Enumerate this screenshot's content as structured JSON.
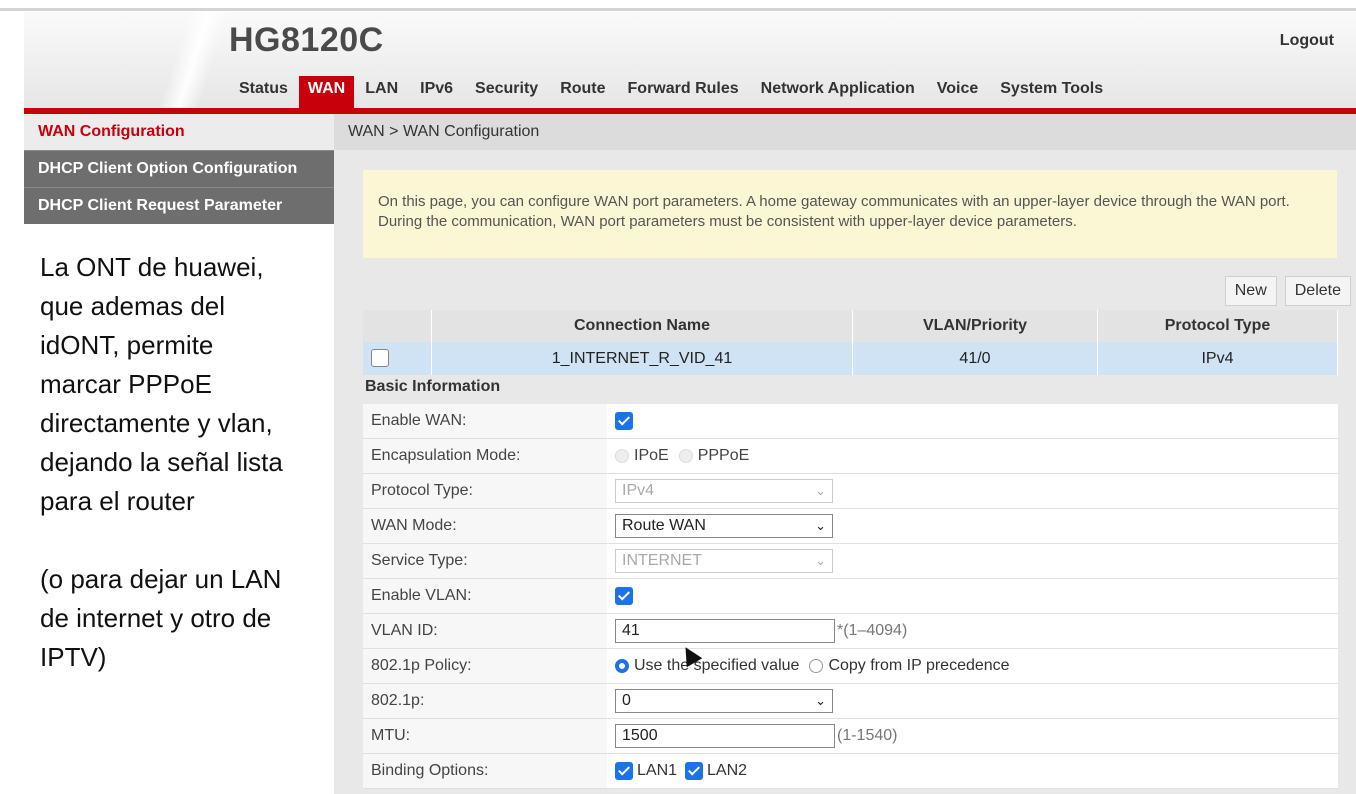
{
  "header": {
    "title": "HG8120C",
    "logout": "Logout"
  },
  "nav": [
    "Status",
    "WAN",
    "LAN",
    "IPv6",
    "Security",
    "Route",
    "Forward Rules",
    "Network Application",
    "Voice",
    "System Tools"
  ],
  "nav_active": "WAN",
  "sidebar": {
    "items": [
      "WAN Configuration",
      "DHCP Client Option Configuration",
      "DHCP Client Request Parameter"
    ]
  },
  "annotation": {
    "para1": "La ONT de huawei,\nque ademas del\nidONT, permite\nmarcar PPPoE\ndirectamente y vlan,\ndejando la señal lista\npara el router",
    "para2": "(o para dejar un LAN\nde internet y otro de\nIPTV)"
  },
  "breadcrumb": "WAN > WAN Configuration",
  "notice": "On this page, you can configure WAN port parameters. A home gateway communicates with an upper-layer device through the WAN port. During the communication, WAN port parameters must be consistent with upper-layer device parameters.",
  "buttons": {
    "new": "New",
    "delete": "Delete"
  },
  "connections": {
    "headers": [
      "Connection Name",
      "VLAN/Priority",
      "Protocol Type"
    ],
    "rows": [
      {
        "name": "1_INTERNET_R_VID_41",
        "vlan_priority": "41/0",
        "protocol": "IPv4"
      }
    ]
  },
  "basic_info": {
    "title": "Basic Information",
    "enable_wan": {
      "label": "Enable WAN:",
      "checked": true
    },
    "encapsulation": {
      "label": "Encapsulation Mode:",
      "options": [
        "IPoE",
        "PPPoE"
      ]
    },
    "protocol_type": {
      "label": "Protocol Type:",
      "value": "IPv4"
    },
    "wan_mode": {
      "label": "WAN Mode:",
      "value": "Route WAN"
    },
    "service_type": {
      "label": "Service Type:",
      "value": "INTERNET"
    },
    "enable_vlan": {
      "label": "Enable VLAN:",
      "checked": true
    },
    "vlan_id": {
      "label": "VLAN ID:",
      "value": "41",
      "hint": "*(1–4094)"
    },
    "policy": {
      "label": "802.1p Policy:",
      "opt1": "Use the specified value",
      "opt2": "Copy from IP precedence"
    },
    "p8021": {
      "label": "802.1p:",
      "value": "0"
    },
    "mtu": {
      "label": "MTU:",
      "value": "1500",
      "hint": "(1-1540)"
    },
    "binding": {
      "label": "Binding Options:",
      "lan1": "LAN1",
      "lan2": "LAN2"
    }
  },
  "colors": {
    "accent": "#c7000b",
    "selected_row": "#cfe3f5",
    "notice_bg": "#fbf6d3",
    "checkbox": "#1a73e8"
  }
}
